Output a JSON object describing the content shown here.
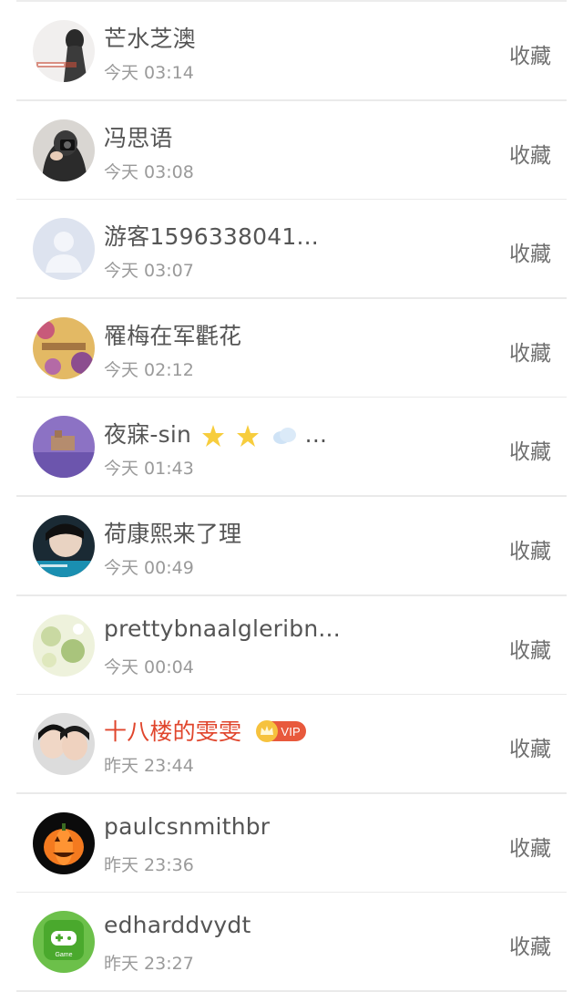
{
  "fav_label": "收藏",
  "rows": [
    {
      "name": "芒水芝澳",
      "time": "今天 03:14",
      "avatar": "photo-girl-avatar"
    },
    {
      "name": "冯思语",
      "time": "今天 03:08",
      "avatar": "photo-camera-avatar"
    },
    {
      "name": "游客1596338041...",
      "time": "今天 03:07",
      "avatar": "default-user-avatar"
    },
    {
      "name": "罹梅在军氍花",
      "time": "今天 02:12",
      "avatar": "photo-flowers-avatar"
    },
    {
      "name": "夜寐-sin",
      "time": "今天 01:43",
      "avatar": "photo-purple-avatar",
      "emoji_suffix": "..."
    },
    {
      "name": "荷康熙来了理",
      "time": "今天 00:49",
      "avatar": "photo-boy-avatar"
    },
    {
      "name": "prettybnaalgleribn...",
      "time": "今天 00:04",
      "avatar": "photo-green-avatar"
    },
    {
      "name": "十八楼的雯雯",
      "time": "昨天 23:44",
      "avatar": "photo-kids-avatar",
      "vip": "VIP"
    },
    {
      "name": "paulcsnmithbr",
      "time": "昨天 23:36",
      "avatar": "pumpkin-avatar"
    },
    {
      "name": "edharddvydt",
      "time": "昨天 23:27",
      "avatar": "game-app-avatar",
      "avatar_text": "Game"
    }
  ],
  "colors": {
    "vip_name": "#e0452c",
    "vip_badge": "#e8593c",
    "text": "#555555",
    "time": "#9a9a9a"
  }
}
